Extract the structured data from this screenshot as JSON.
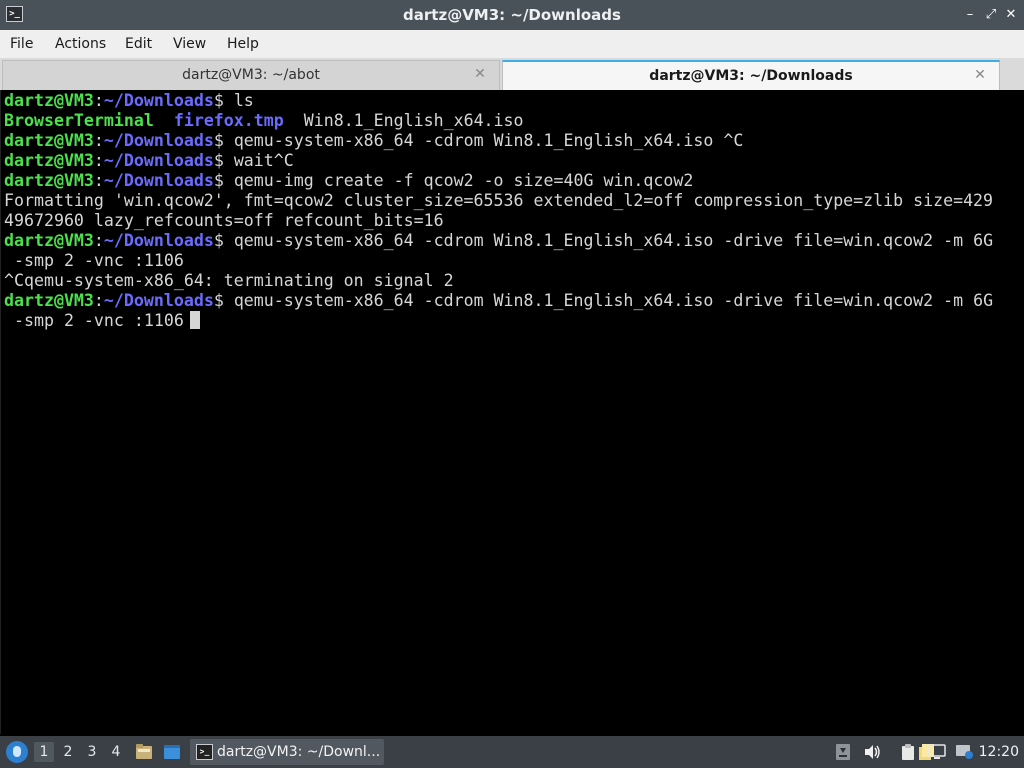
{
  "window": {
    "title": "dartz@VM3: ~/Downloads",
    "app_icon": ">_",
    "minimize_icon": "–",
    "maximize_icon": "⤢",
    "close_icon": "✕"
  },
  "menu": {
    "file": "File",
    "actions": "Actions",
    "edit": "Edit",
    "view": "View",
    "help": "Help"
  },
  "tabs": [
    {
      "label": "dartz@VM3: ~/abot",
      "active": false
    },
    {
      "label": "dartz@VM3: ~/Downloads",
      "active": true
    }
  ],
  "tab_close_icon": "✕",
  "terminal": {
    "prompt_user": "dartz@VM3",
    "prompt_sep": ":",
    "prompt_path": "~/Downloads",
    "prompt_dollar": "$ ",
    "lines": [
      {
        "type": "prompt",
        "cmd": "ls"
      },
      {
        "type": "ls",
        "items": [
          "BrowserTerminal",
          "  ",
          "firefox.tmp",
          "  Win8.1_English_x64.iso"
        ]
      },
      {
        "type": "prompt",
        "cmd": "qemu-system-x86_64 -cdrom Win8.1_English_x64.iso ^C"
      },
      {
        "type": "prompt",
        "cmd": "wait^C"
      },
      {
        "type": "prompt",
        "cmd": "qemu-img create -f qcow2 -o size=40G win.qcow2"
      },
      {
        "type": "text",
        "text": "Formatting 'win.qcow2', fmt=qcow2 cluster_size=65536 extended_l2=off compression_type=zlib size=429"
      },
      {
        "type": "text",
        "text": "49672960 lazy_refcounts=off refcount_bits=16"
      },
      {
        "type": "prompt",
        "cmd": "qemu-system-x86_64 -cdrom Win8.1_English_x64.iso -drive file=win.qcow2 -m 6G"
      },
      {
        "type": "text",
        "text": " -smp 2 -vnc :1106"
      },
      {
        "type": "text",
        "text": "^Cqemu-system-x86_64: terminating on signal 2"
      },
      {
        "type": "prompt",
        "cmd": "qemu-system-x86_64 -cdrom Win8.1_English_x64.iso -drive file=win.qcow2 -m 6G"
      },
      {
        "type": "current",
        "text": " -smp 2 -vnc :1106"
      }
    ]
  },
  "taskbar": {
    "workspaces": [
      "1",
      "2",
      "3",
      "4"
    ],
    "active_workspace": "1",
    "task_label": "dartz@VM3: ~/Downl...",
    "clock": "12:20"
  },
  "colors": {
    "prompt_user": "#4be14b",
    "prompt_path": "#6b6bff",
    "terminal_text": "#d6d6d6",
    "accent": "#3daee9"
  }
}
